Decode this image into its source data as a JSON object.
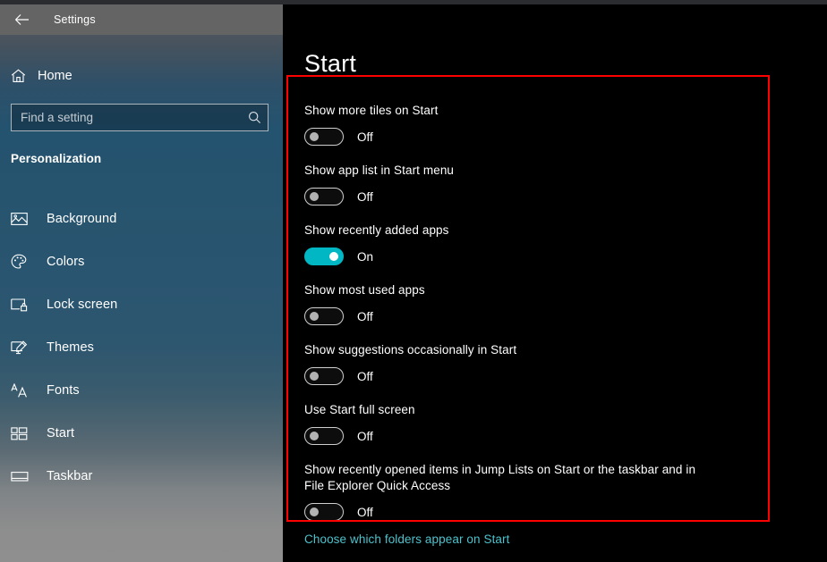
{
  "window": {
    "titlebar": {
      "title": "Settings",
      "back_icon": "back-arrow-icon"
    }
  },
  "sidebar": {
    "home": {
      "label": "Home",
      "icon": "home-icon"
    },
    "search": {
      "value": "",
      "placeholder": "Find a setting",
      "icon": "search-icon"
    },
    "section_title": "Personalization",
    "items": [
      {
        "label": "Background",
        "icon": "image-icon"
      },
      {
        "label": "Colors",
        "icon": "palette-icon"
      },
      {
        "label": "Lock screen",
        "icon": "lock-screen-icon"
      },
      {
        "label": "Themes",
        "icon": "theme-brush-icon"
      },
      {
        "label": "Fonts",
        "icon": "fonts-icon"
      },
      {
        "label": "Start",
        "icon": "start-tiles-icon"
      },
      {
        "label": "Taskbar",
        "icon": "taskbar-icon"
      }
    ]
  },
  "main": {
    "page_title": "Start",
    "settings": [
      {
        "label": "Show more tiles on Start",
        "state": "Off",
        "on": false
      },
      {
        "label": "Show app list in Start menu",
        "state": "Off",
        "on": false
      },
      {
        "label": "Show recently added apps",
        "state": "On",
        "on": true
      },
      {
        "label": "Show most used apps",
        "state": "Off",
        "on": false
      },
      {
        "label": "Show suggestions occasionally in Start",
        "state": "Off",
        "on": false
      },
      {
        "label": "Use Start full screen",
        "state": "Off",
        "on": false
      },
      {
        "label": "Show recently opened items in Jump Lists on Start or the taskbar and in File Explorer Quick Access",
        "state": "Off",
        "on": false
      }
    ],
    "link": "Choose which folders appear on Start"
  },
  "annotation": {
    "color": "#ff0000",
    "shape": "rectangle"
  },
  "colors": {
    "toggle_on": "#00b7c3",
    "link": "#4cc2cc",
    "annotation": "#ff0000"
  }
}
